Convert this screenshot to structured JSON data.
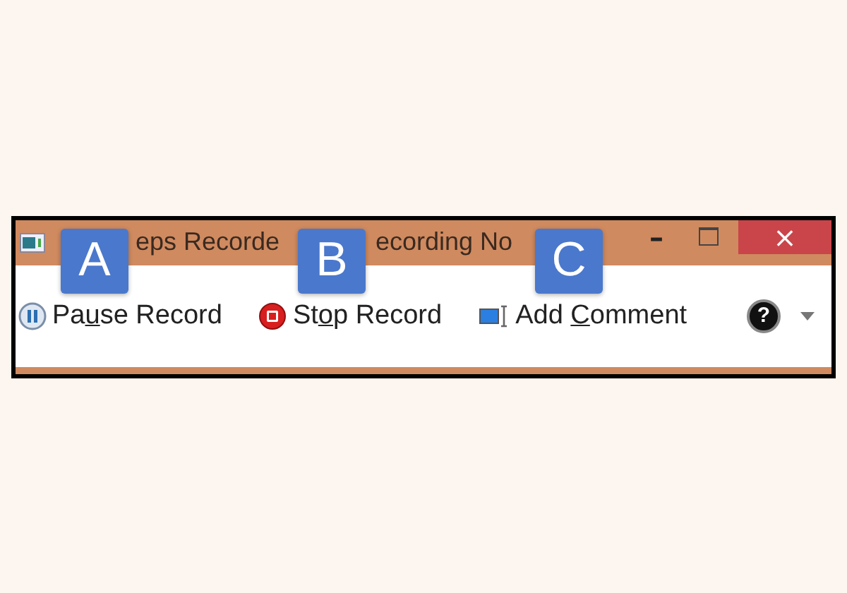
{
  "window": {
    "title_parts": [
      "eps Recorde",
      "ecording No"
    ],
    "controls": [
      {
        "kind": "minimize",
        "label": "–"
      },
      {
        "kind": "maximize"
      },
      {
        "kind": "close",
        "label": "×"
      }
    ]
  },
  "toolbar": [
    {
      "kind": "pause",
      "before": "Pa",
      "key": "u",
      "after": "se Record"
    },
    {
      "kind": "stop",
      "before": "St",
      "key": "o",
      "after": "p Record"
    },
    {
      "kind": "comment",
      "before": "Add ",
      "key": "C",
      "after": "omment"
    }
  ],
  "help": {
    "label": "?"
  },
  "callouts": [
    "A",
    "B",
    "C"
  ]
}
